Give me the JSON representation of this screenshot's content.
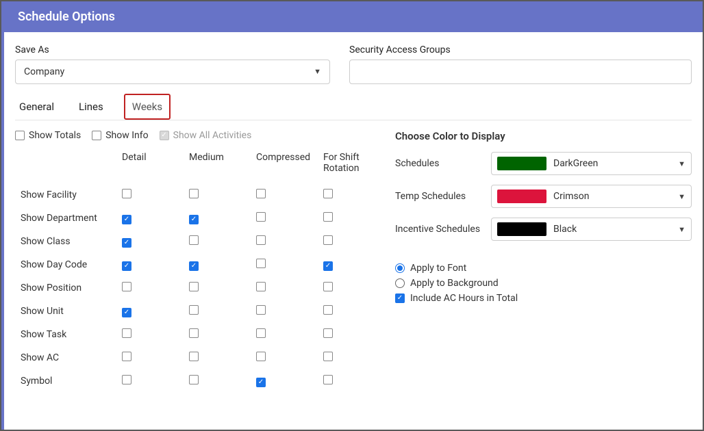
{
  "title": "Schedule Options",
  "saveAs": {
    "label": "Save As",
    "value": "Company"
  },
  "security": {
    "label": "Security Access Groups",
    "value": ""
  },
  "tabs": [
    "General",
    "Lines",
    "Weeks"
  ],
  "activeTab": "Weeks",
  "toggles": {
    "showTotals": {
      "label": "Show Totals",
      "checked": false
    },
    "showInfo": {
      "label": "Show Info",
      "checked": false
    },
    "showAllActivities": {
      "label": "Show All Activities",
      "checked": true,
      "disabled": true
    }
  },
  "grid": {
    "cols": [
      "Detail",
      "Medium",
      "Compressed",
      "For Shift Rotation"
    ],
    "rows": [
      {
        "label": "Show Facility",
        "c": [
          false,
          false,
          false,
          false
        ]
      },
      {
        "label": "Show Department",
        "c": [
          true,
          true,
          false,
          false
        ]
      },
      {
        "label": "Show Class",
        "c": [
          true,
          false,
          false,
          false
        ]
      },
      {
        "label": "Show Day Code",
        "c": [
          true,
          true,
          false,
          true
        ]
      },
      {
        "label": "Show Position",
        "c": [
          false,
          false,
          false,
          false
        ]
      },
      {
        "label": "Show Unit",
        "c": [
          true,
          false,
          false,
          false
        ]
      },
      {
        "label": "Show Task",
        "c": [
          false,
          false,
          false,
          false
        ]
      },
      {
        "label": "Show AC",
        "c": [
          false,
          false,
          false,
          false
        ]
      },
      {
        "label": "Symbol",
        "c": [
          false,
          false,
          true,
          false
        ]
      }
    ]
  },
  "colors": {
    "title": "Choose Color to Display",
    "items": [
      {
        "label": "Schedules",
        "name": "DarkGreen",
        "hex": "#006400"
      },
      {
        "label": "Temp Schedules",
        "name": "Crimson",
        "hex": "#DC143C"
      },
      {
        "label": "Incentive Schedules",
        "name": "Black",
        "hex": "#000000"
      }
    ]
  },
  "applyOptions": {
    "font": "Apply to Font",
    "background": "Apply to Background",
    "selected": "font",
    "includeAC": {
      "label": "Include AC Hours in Total",
      "checked": true
    }
  }
}
